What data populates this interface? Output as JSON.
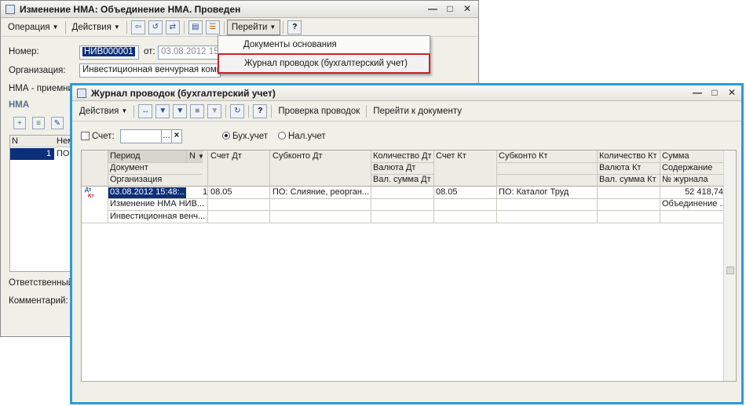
{
  "back_window": {
    "title": "Изменение НМА: Объединение НМА. Проведен",
    "toolbar": {
      "operation_label": "Операция",
      "actions_label": "Действия",
      "goto_label": "Перейти"
    },
    "fields": {
      "number_label": "Номер:",
      "number_value": "НИВ000001",
      "from_label": "от:",
      "date_value": "03.08.2012 15:",
      "org_label": "Организация:",
      "org_value": "Инвестиционная венчурная компа",
      "nma_receiver_label": "НМА - приемни",
      "nma_section": "НМА",
      "table_col_n": "N",
      "table_col_nem": "Нем",
      "row_n": "1",
      "row_val": "ПО:",
      "responsible_label": "Ответственный",
      "comment_label": "Комментарий:"
    }
  },
  "menu": {
    "items": [
      {
        "label": "Документы основания"
      },
      {
        "label": "Журнал проводок (бухгалтерский учет)"
      }
    ]
  },
  "front_window": {
    "title": "Журнал проводок (бухгалтерский учет)",
    "toolbar": {
      "actions_label": "Действия",
      "check_label": "Проверка проводок",
      "goto_doc_label": "Перейти к документу"
    },
    "filter": {
      "account_label": "Счет:",
      "radio_buh": "Бух.учет",
      "radio_nal": "Нал.учет"
    },
    "grid": {
      "headers": {
        "period": "Период",
        "n": "N",
        "document": "Документ",
        "organization": "Организация",
        "schet_dt": "Счет Дт",
        "subkonto_dt": "Субконто Дт",
        "kol_dt": "Количество Дт",
        "val_dt": "Валюта Дт",
        "valsum_dt": "Вал. сумма Дт",
        "schet_kt": "Счет Кт",
        "subkonto_kt": "Субконто Кт",
        "kol_kt": "Количество Кт",
        "val_kt": "Валюта Кт",
        "valsum_kt": "Вал. сумма Кт",
        "summa": "Сумма",
        "soderzhanie": "Содержание",
        "nomer_zhurnala": "№ журнала"
      },
      "row": {
        "icon_dt": "Дт",
        "icon_kt": "Кт",
        "period": "03.08.2012 15:48:...",
        "n": "1",
        "document": "Изменение НМА НИВ...",
        "organization": "Инвестиционная венч...",
        "schet_dt": "08.05",
        "subkonto_dt": "ПО: Слияние, реорган...",
        "schet_kt": "08.05",
        "subkonto_kt": "ПО: Каталог Труд",
        "summa": "52 418,74",
        "soderzhanie": "Объединение ..."
      }
    }
  },
  "colors": {
    "front_border": "#2b9bd8",
    "highlight_outline": "#c3272c",
    "selection": "#0b2f78"
  }
}
